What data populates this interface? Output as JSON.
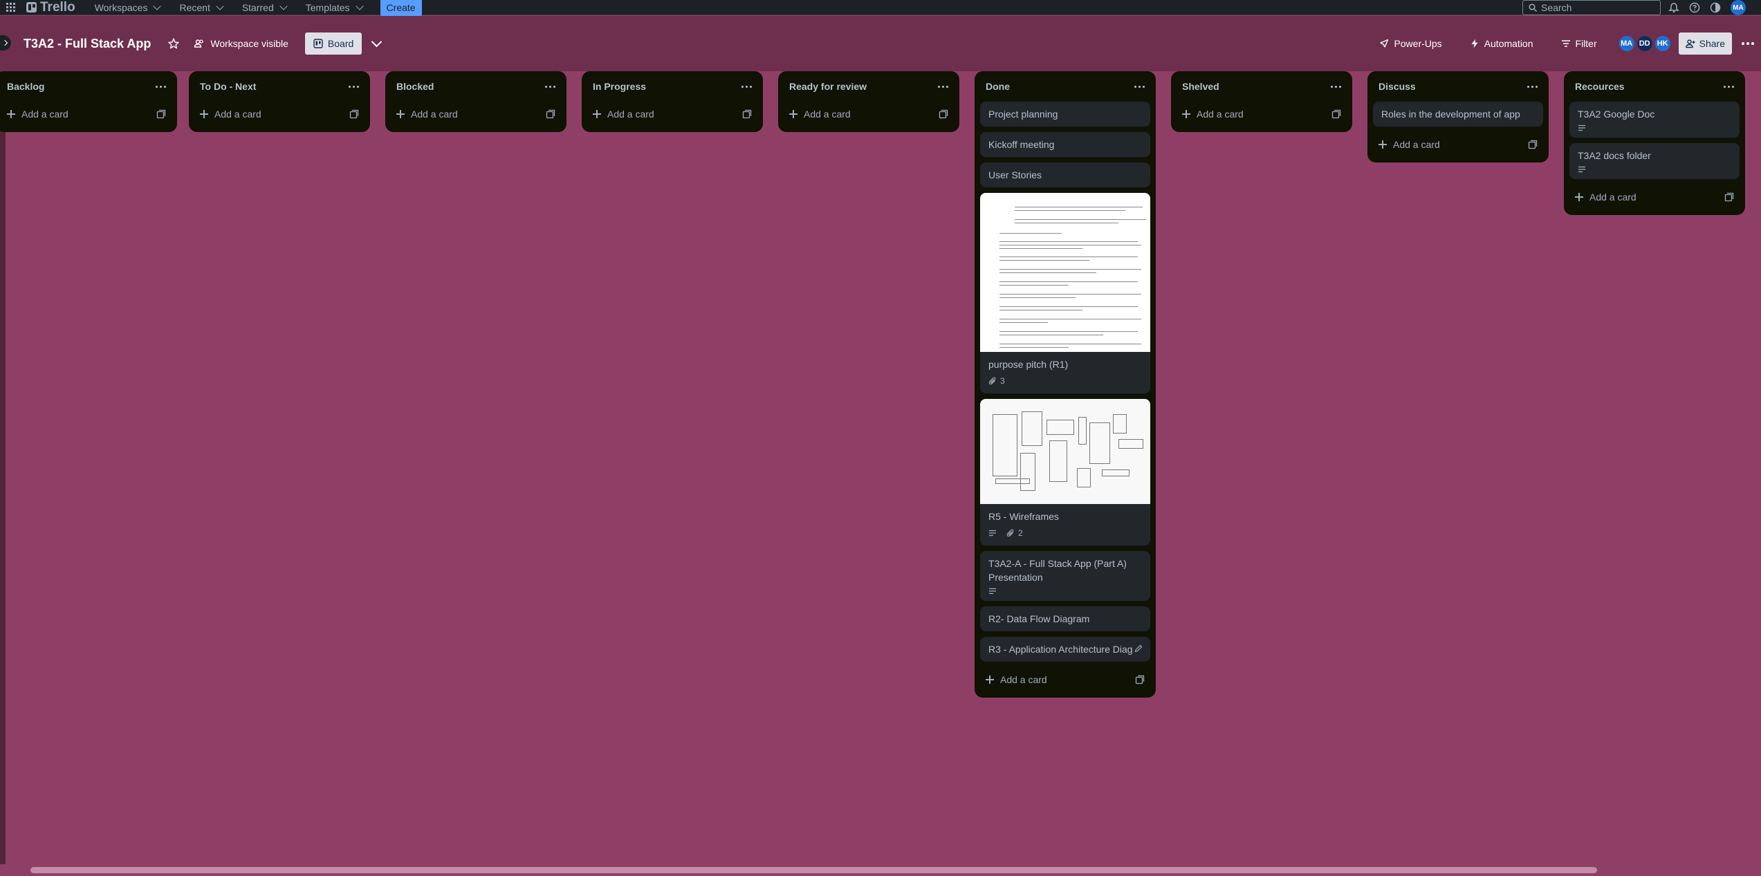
{
  "topnav": {
    "logo_text": "Trello",
    "items": [
      {
        "label": "Workspaces"
      },
      {
        "label": "Recent"
      },
      {
        "label": "Starred"
      },
      {
        "label": "Templates"
      }
    ],
    "create_label": "Create",
    "search_placeholder": "Search",
    "user_initials": "MA"
  },
  "board": {
    "title": "T3A2 - Full Stack App",
    "visibility_label": "Workspace visible",
    "view_label": "Board",
    "powerups_label": "Power-Ups",
    "automation_label": "Automation",
    "filter_label": "Filter",
    "members": [
      {
        "initials": "MA",
        "color": "#1f6fd0"
      },
      {
        "initials": "DD",
        "color": "#0c2d5c"
      },
      {
        "initials": "HK",
        "color": "#1f6fd0"
      }
    ],
    "share_label": "Share"
  },
  "lists": [
    {
      "title": "Backlog",
      "cards": [],
      "add_label": "Add a card"
    },
    {
      "title": "To Do - Next",
      "cards": [],
      "add_label": "Add a card"
    },
    {
      "title": "Blocked",
      "cards": [],
      "add_label": "Add a card"
    },
    {
      "title": "In Progress",
      "cards": [],
      "add_label": "Add a card"
    },
    {
      "title": "Ready for review",
      "cards": [],
      "add_label": "Add a card"
    },
    {
      "title": "Done",
      "add_label": "Add a card",
      "cards": [
        {
          "title": "Project planning"
        },
        {
          "title": "Kickoff meeting"
        },
        {
          "title": "User Stories"
        },
        {
          "title": "purpose pitch (R1)",
          "cover": "document",
          "attachments": "3"
        },
        {
          "title": "R5 - Wireframes",
          "cover": "wireframe",
          "description": true,
          "attachments": "2"
        },
        {
          "title": "T3A2-A - Full Stack App (Part A) Presentation",
          "description": true
        },
        {
          "title": "R2- Data Flow Diagram"
        },
        {
          "title": "R3 - Application Architecture Diag",
          "editing": true
        }
      ]
    },
    {
      "title": "Shelved",
      "cards": [],
      "add_label": "Add a card"
    },
    {
      "title": "Discuss",
      "add_label": "Add a card",
      "cards": [
        {
          "title": "Roles in the development of app"
        }
      ]
    },
    {
      "title": "Recources",
      "add_label": "Add a card",
      "cards": [
        {
          "title": "T3A2 Google Doc",
          "description": true
        },
        {
          "title": "T3A2 docs folder",
          "description": true
        }
      ]
    }
  ],
  "colors": {
    "board_bg": "#8f3f65",
    "header_bg": "#6e2f4e",
    "list_bg": "#101204",
    "card_bg": "#22272b",
    "nav_bg": "#1d2125",
    "accent": "#579dff"
  }
}
